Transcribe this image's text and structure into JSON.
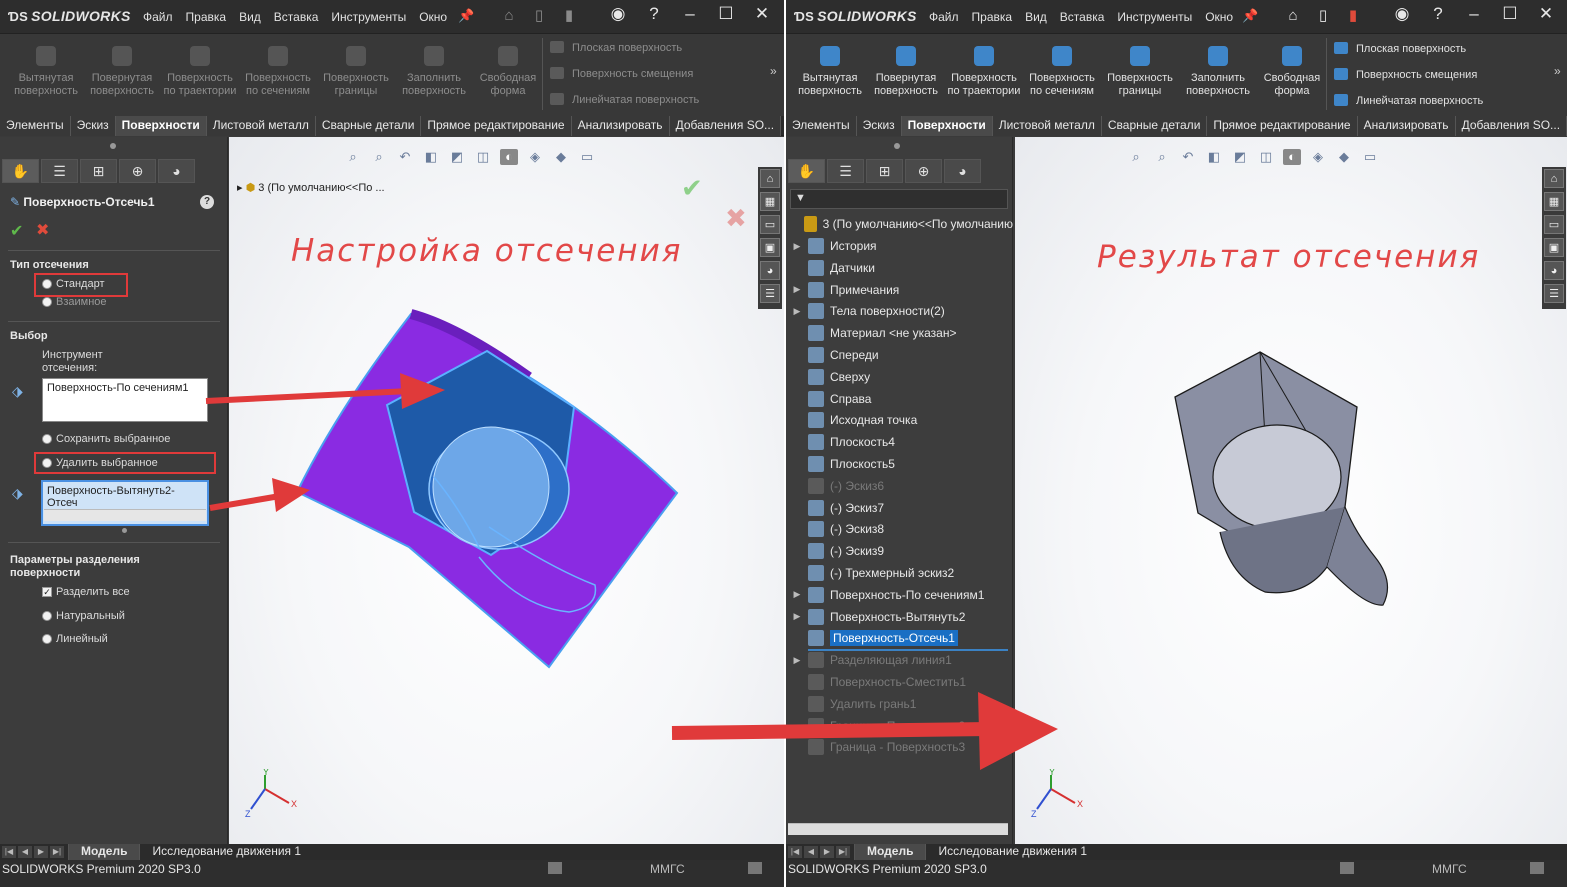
{
  "app": {
    "brand": "SOLIDWORKS",
    "status": "SOLIDWORKS Premium 2020 SP3.0",
    "units": "ММГС"
  },
  "menu": [
    "Файл",
    "Правка",
    "Вид",
    "Вставка",
    "Инструменты",
    "Окно"
  ],
  "ribbon": {
    "buttons": [
      "Вытянутая поверхность",
      "Повернутая поверхность",
      "Поверхность по траектории",
      "Поверхность по сечениям",
      "Поверхность границы",
      "Заполнить поверхность",
      "Свободная форма"
    ],
    "small": [
      "Плоская поверхность",
      "Поверхность смещения",
      "Линейчатая поверхность"
    ]
  },
  "command_tabs": [
    "Элементы",
    "Эскиз",
    "Поверхности",
    "Листовой металл",
    "Сварные детали",
    "Прямое редактирование",
    "Анализировать",
    "Добавления SO..."
  ],
  "command_tabs_active": "Поверхности",
  "left": {
    "view_title": "Настройка отсечения",
    "breadcrumb_number": "3",
    "breadcrumb": "(По умолчанию<<По ...",
    "property_manager": {
      "title": "Поверхность-Отсечь1",
      "help": "?",
      "trim_type_label": "Тип отсечения",
      "trim_standard": "Стандарт",
      "trim_mutual": "Взаимное",
      "selection_label": "Выбор",
      "tool_label": "Инструмент отсечения:",
      "tool_value": "Поверхность-По сечениям1",
      "keep_selected": "Сохранить выбранное",
      "remove_selected": "Удалить выбранное",
      "pieces_value": "Поверхность-Вытянуть2-Отсеч",
      "split_label": "Параметры разделения поверхности",
      "split_all": "Разделить все",
      "natural": "Натуральный",
      "linear": "Линейный"
    }
  },
  "right": {
    "view_title": "Результат отсечения",
    "tree_root_number": "3",
    "tree_root": "(По умолчанию<<По умолчанию",
    "tree": [
      {
        "label": "История",
        "arrow": true,
        "dim": false
      },
      {
        "label": "Датчики",
        "arrow": false,
        "dim": false
      },
      {
        "label": "Примечания",
        "arrow": true,
        "dim": false
      },
      {
        "label": "Тела поверхности(2)",
        "arrow": true,
        "dim": false
      },
      {
        "label": "Материал <не указан>",
        "arrow": false,
        "dim": false
      },
      {
        "label": "Спереди",
        "arrow": false,
        "dim": false
      },
      {
        "label": "Сверху",
        "arrow": false,
        "dim": false
      },
      {
        "label": "Справа",
        "arrow": false,
        "dim": false
      },
      {
        "label": "Исходная точка",
        "arrow": false,
        "dim": false
      },
      {
        "label": "Плоскость4",
        "arrow": false,
        "dim": false
      },
      {
        "label": "Плоскость5",
        "arrow": false,
        "dim": false
      },
      {
        "label": "(-) Эскиз6",
        "arrow": false,
        "dim": true
      },
      {
        "label": "(-) Эскиз7",
        "arrow": false,
        "dim": false
      },
      {
        "label": "(-) Эскиз8",
        "arrow": false,
        "dim": false
      },
      {
        "label": "(-) Эскиз9",
        "arrow": false,
        "dim": false
      },
      {
        "label": "(-) Трехмерный эскиз2",
        "arrow": false,
        "dim": false
      },
      {
        "label": "Поверхность-По сечениям1",
        "arrow": true,
        "dim": false
      },
      {
        "label": "Поверхность-Вытянуть2",
        "arrow": true,
        "dim": false
      },
      {
        "label": "Поверхность-Отсечь1",
        "arrow": false,
        "dim": false,
        "selected": true
      },
      {
        "label": "Разделяющая линия1",
        "arrow": true,
        "dim": true
      },
      {
        "label": "Поверхность-Сместить1",
        "arrow": false,
        "dim": true
      },
      {
        "label": "Удалить грань1",
        "arrow": false,
        "dim": true
      },
      {
        "label": "Граница - Поверхность2",
        "arrow": false,
        "dim": true
      },
      {
        "label": "Граница - Поверхность3",
        "arrow": false,
        "dim": true
      }
    ]
  },
  "bottom_tabs": [
    "Модель",
    "Исследование движения 1"
  ],
  "triad": {
    "x": "X",
    "y": "Y",
    "z": "Z"
  },
  "colors": {
    "accent": "#1a6fc4",
    "annotation": "#e24848",
    "surface_purple": "#8a2be2",
    "surface_blue": "#1e5aa8",
    "result_grey": "#8a8fa3"
  }
}
